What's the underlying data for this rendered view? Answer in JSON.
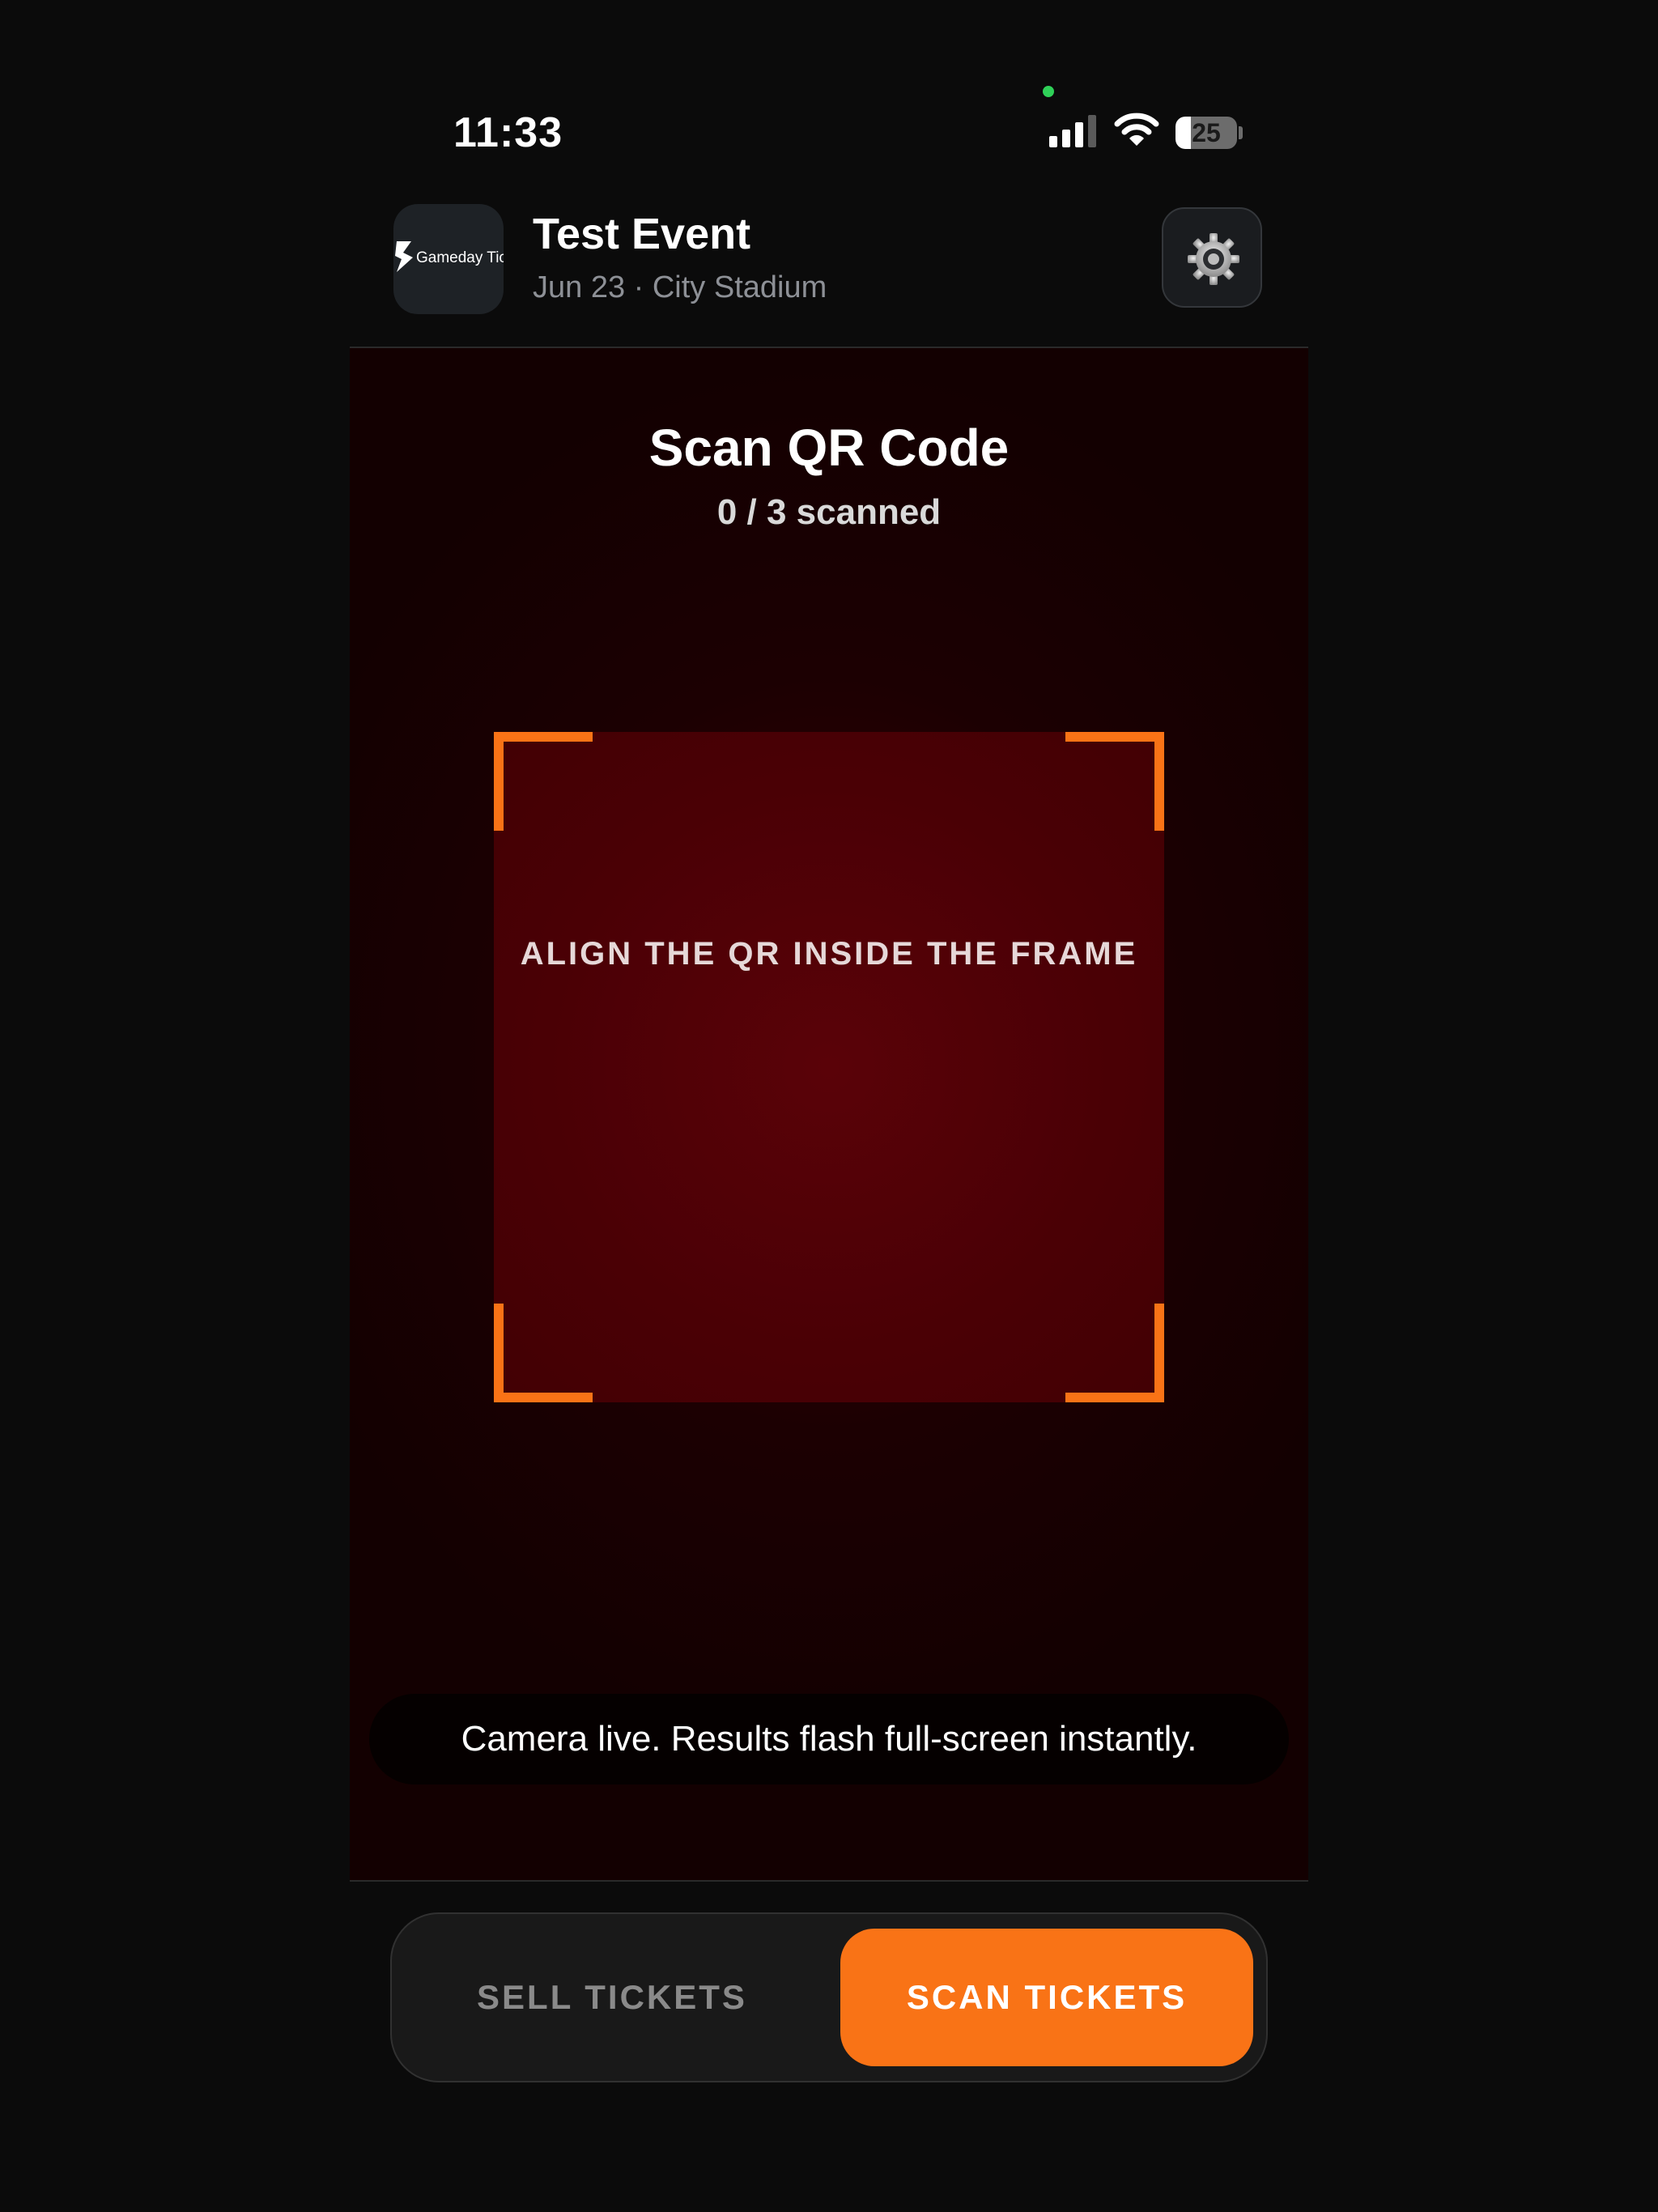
{
  "status_bar": {
    "time": "11:33",
    "battery_level": "25",
    "battery_fraction": 0.25,
    "camera_indicator_color": "#2fd158",
    "icons": [
      "signal-icon",
      "wifi-icon",
      "battery-icon"
    ]
  },
  "header": {
    "logo_text": "Gameday Tick",
    "event_title": "Test Event",
    "event_subtitle": "Jun 23 · City Stadium",
    "settings_icon": "gear-icon"
  },
  "scanner": {
    "title": "Scan QR Code",
    "count": "0 / 3 scanned",
    "frame_hint": "ALIGN THE QR INSIDE THE FRAME",
    "toast": "Camera live. Results flash full-screen instantly."
  },
  "tabs": [
    {
      "label": "SELL TICKETS",
      "active": false
    },
    {
      "label": "SCAN TICKETS",
      "active": true
    }
  ],
  "colors": {
    "accent": "#f97316",
    "background": "#0b0b0b",
    "scanner_tint": "#4a0005"
  }
}
